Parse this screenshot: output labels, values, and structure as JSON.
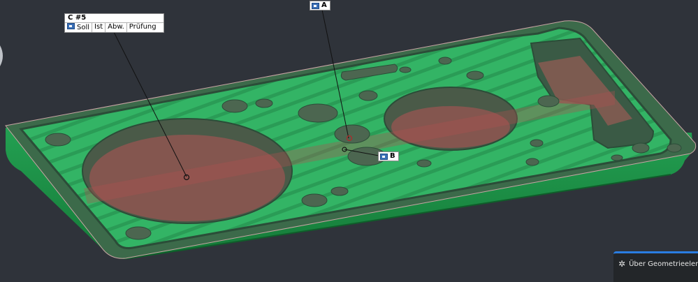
{
  "label_c": {
    "title": "C  #5",
    "columns": [
      "Soll",
      "Ist",
      "Abw.",
      "Prüfung"
    ]
  },
  "tag_a": {
    "label": "A"
  },
  "tag_b": {
    "label": "B"
  },
  "panel": {
    "label": "Über Geometrieelemente",
    "icon": "gear-icon"
  },
  "colors": {
    "background": "#2f333a",
    "part_green": "#2fae5e",
    "part_dark": "#1a7a3c",
    "highlight": "#a2504d",
    "panel_accent": "#2a7de1"
  }
}
